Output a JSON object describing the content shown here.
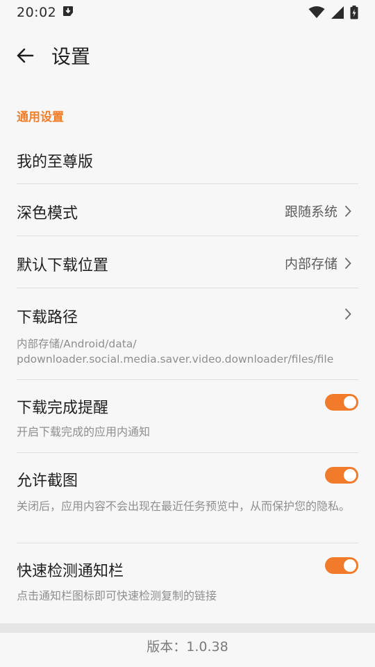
{
  "status_bar": {
    "time": "20:02",
    "icons": [
      "download-notification-icon",
      "wifi-icon",
      "signal-icon",
      "battery-charging-icon"
    ]
  },
  "app_bar": {
    "back_icon": "arrow-left-icon",
    "title": "设置"
  },
  "section": {
    "title": "通用设置"
  },
  "rows": [
    {
      "title": "我的至尊版"
    },
    {
      "title": "深色模式",
      "value": "跟随系统",
      "icon": "chevron-right-icon"
    },
    {
      "title": "默认下载位置",
      "value": "内部存储",
      "icon": "chevron-right-icon"
    },
    {
      "title": "下载路径",
      "subtitle": "内部存储/Android/data/\npdownloader.social.media.saver.video.downloader/files/file",
      "icon": "chevron-right-icon"
    },
    {
      "title": "下载完成提醒",
      "subtitle": "开启下载完成的应用内通知",
      "toggle": true
    },
    {
      "title": "允许截图",
      "subtitle": "关闭后，应用内容不会出现在最近任务预览中，从而保护您的隐私。",
      "toggle": true
    },
    {
      "title": "快速检测通知栏",
      "subtitle": "点击通知栏图标即可快速检测复制的链接",
      "toggle": true
    }
  ],
  "footer": {
    "version": "版本：1.0.38"
  },
  "colors": {
    "accent": "#f27b2b",
    "background": "#f7f7f7"
  }
}
